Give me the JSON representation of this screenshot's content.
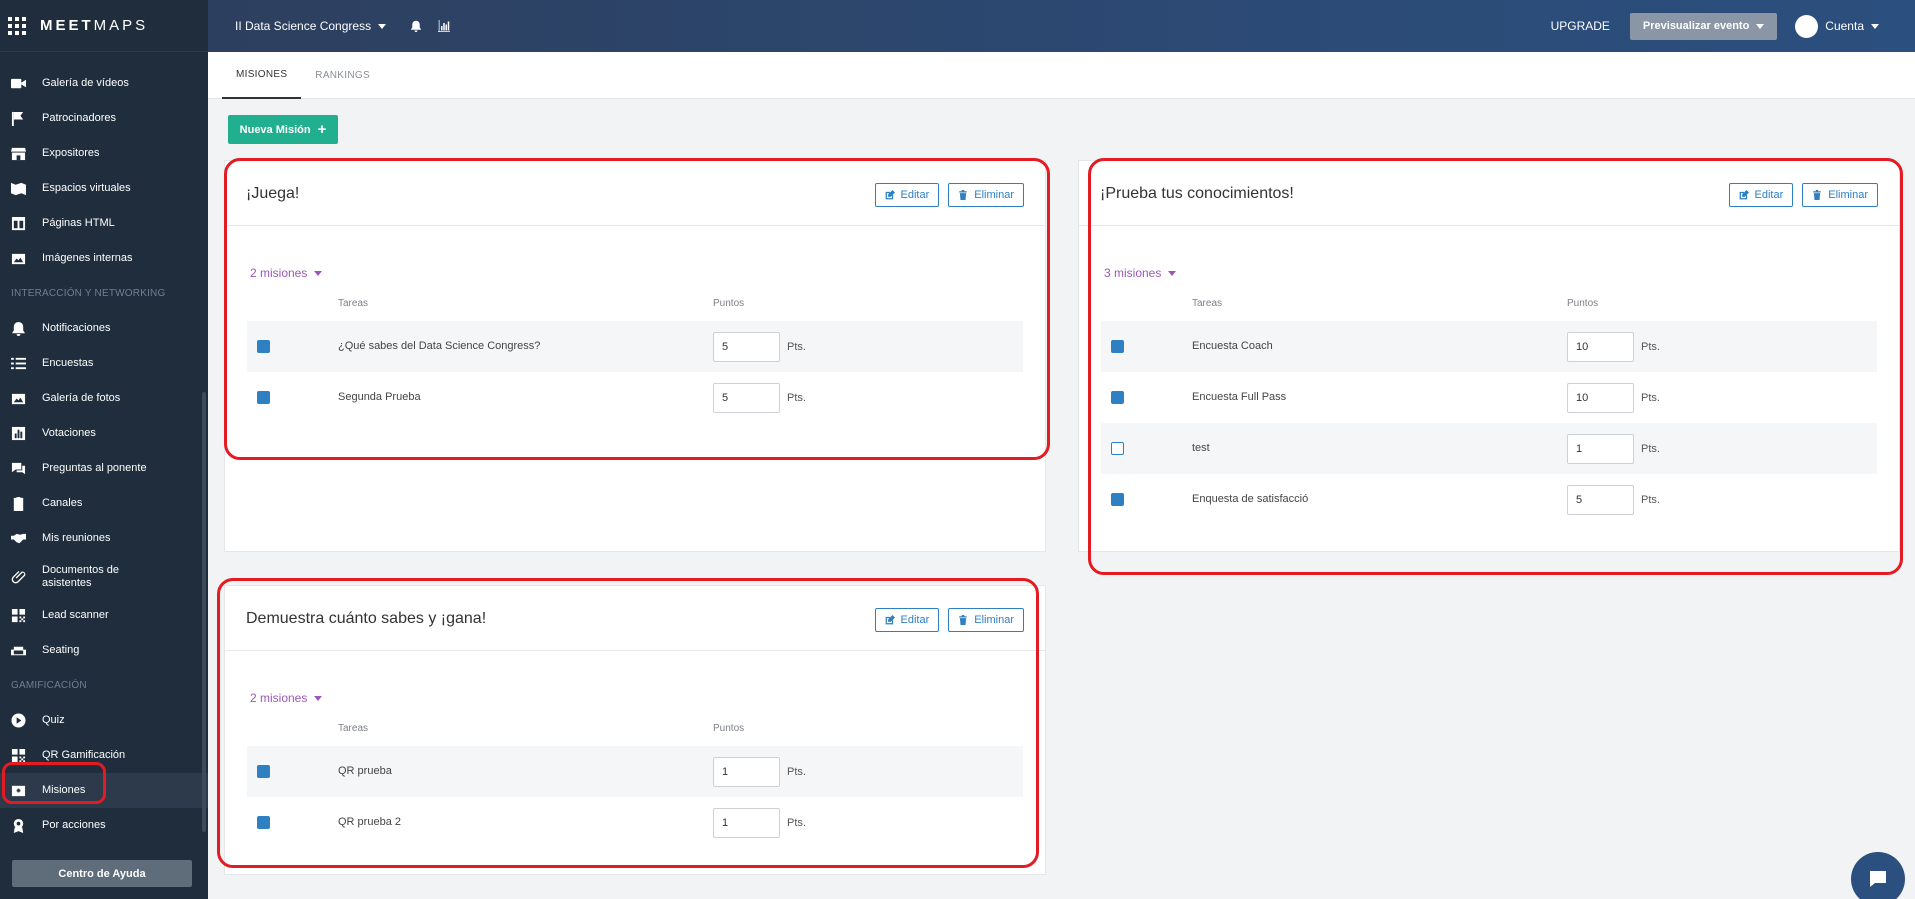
{
  "brand": {
    "logo_bold": "MEET",
    "logo_light": "MAPS"
  },
  "sidebar": {
    "items": [
      {
        "label": "Galería de vídeos",
        "icon": "video-icon"
      },
      {
        "label": "Patrocinadores",
        "icon": "flag-icon"
      },
      {
        "label": "Expositores",
        "icon": "store-icon"
      },
      {
        "label": "Espacios virtuales",
        "icon": "map-icon"
      },
      {
        "label": "Páginas HTML",
        "icon": "layout-icon"
      },
      {
        "label": "Imágenes internas",
        "icon": "image-icon"
      }
    ],
    "section_networking": "INTERACCIÓN Y NETWORKING",
    "networking_items": [
      {
        "label": "Notificaciones",
        "icon": "bell-icon"
      },
      {
        "label": "Encuestas",
        "icon": "list-icon"
      },
      {
        "label": "Galería de fotos",
        "icon": "photo-icon"
      },
      {
        "label": "Votaciones",
        "icon": "chart-icon"
      },
      {
        "label": "Preguntas al ponente",
        "icon": "chat-icon"
      },
      {
        "label": "Canales",
        "icon": "clipboard-icon"
      },
      {
        "label": "Mis reuniones",
        "icon": "handshake-icon"
      },
      {
        "label": "Documentos de asistentes",
        "icon": "paperclip-icon"
      },
      {
        "label": "Lead scanner",
        "icon": "qr-icon"
      },
      {
        "label": "Seating",
        "icon": "sofa-icon"
      }
    ],
    "section_gamification": "GAMIFICACIÓN",
    "gamification_items": [
      {
        "label": "Quiz",
        "icon": "play-icon"
      },
      {
        "label": "QR Gamificación",
        "icon": "qr-icon"
      },
      {
        "label": "Misiones",
        "icon": "mission-icon"
      },
      {
        "label": "Por acciones",
        "icon": "award-icon"
      }
    ],
    "help_button": "Centro de Ayuda"
  },
  "topbar": {
    "event_title": "II Data Science Congress",
    "upgrade": "UPGRADE",
    "preview_button": "Previsualizar evento",
    "account": "Cuenta"
  },
  "tabs": [
    {
      "label": "MISIONES"
    },
    {
      "label": "RANKINGS"
    }
  ],
  "new_mission_button": "Nueva Misión",
  "labels": {
    "edit": "Editar",
    "delete": "Eliminar",
    "tasks_col": "Tareas",
    "points_col": "Puntos",
    "pts": "Pts."
  },
  "missions": [
    {
      "title": "¡Juega!",
      "count": "2 misiones",
      "tasks": [
        {
          "name": "¿Qué sabes del Data Science Congress?",
          "points": "5",
          "checked": true
        },
        {
          "name": "Segunda Prueba",
          "points": "5",
          "checked": true
        }
      ]
    },
    {
      "title": "¡Prueba tus conocimientos!",
      "count": "3 misiones",
      "tasks": [
        {
          "name": "Encuesta Coach",
          "points": "10",
          "checked": true
        },
        {
          "name": "Encuesta Full Pass",
          "points": "10",
          "checked": true
        },
        {
          "name": "test",
          "points": "1",
          "checked": false
        },
        {
          "name": "Enquesta de satisfacció",
          "points": "5",
          "checked": true
        }
      ]
    },
    {
      "title": "Demuestra cuánto sabes y ¡gana!",
      "count": "2 misiones",
      "tasks": [
        {
          "name": "QR prueba",
          "points": "1",
          "checked": true
        },
        {
          "name": "QR prueba 2",
          "points": "1",
          "checked": true
        }
      ]
    }
  ],
  "colors": {
    "accent": "#2f80c2",
    "primary_green": "#20b08f",
    "highlight": "#e31b23",
    "count_purple": "#9b59b6"
  }
}
